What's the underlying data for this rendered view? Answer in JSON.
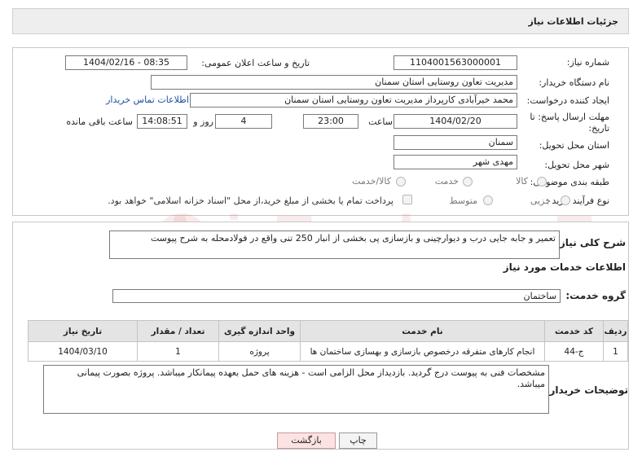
{
  "header": {
    "title": "جزئیات اطلاعات نیاز"
  },
  "form": {
    "need_number_label": "شماره نیاز:",
    "need_number": "1104001563000001",
    "announce_label": "تاریخ و ساعت اعلان عمومی:",
    "announce_value": "1404/02/16 - 08:35",
    "buyer_org_label": "نام دستگاه خریدار:",
    "buyer_org": "مدیریت تعاون روستایی استان سمنان",
    "requester_label": "ایجاد کننده درخواست:",
    "requester": "محمد خیرآبادی کارپرداز مدیریت تعاون روستایی استان سمنان",
    "contact_link": "اطلاعات تماس خریدار",
    "deadline_label": "مهلت ارسال پاسخ: تا تاریخ:",
    "deadline_date": "1404/02/20",
    "time_label": "ساعت",
    "deadline_time": "23:00",
    "days_value": "4",
    "days_label": "روز و",
    "remaining_time": "14:08:51",
    "remaining_label": "ساعت باقی مانده",
    "province_label": "استان محل تحویل:",
    "province": "سمنان",
    "city_label": "شهر محل تحویل:",
    "city": "مهدی شهر",
    "category_label": "طبقه بندی موضوعی:",
    "category_options": [
      "کالا",
      "خدمت",
      "کالا/خدمت"
    ],
    "process_label": "نوع فرآیند خرید :",
    "process_options": [
      "جزیی",
      "متوسط"
    ],
    "payment_note": "پرداخت تمام یا بخشی از مبلغ خرید،از محل \"اسناد خزانه اسلامی\" خواهد بود."
  },
  "summary": {
    "label": "شرح کلی نیاز:",
    "text": "تعمیر و جابه جایی درب و دیوارچینی و بازسازی پی بخشی از انبار 250 تنی واقع در فولادمحله به شرح پیوست"
  },
  "services": {
    "section_title": "اطلاعات خدمات مورد نیاز",
    "group_label": "گروه خدمت:",
    "group_value": "ساختمان",
    "columns": [
      "ردیف",
      "کد خدمت",
      "نام خدمت",
      "واحد اندازه گیری",
      "تعداد / مقدار",
      "تاریخ نیاز"
    ],
    "rows": [
      [
        "1",
        "ج-44",
        "انجام کارهای متفرقه درخصوص بازسازی و بهسازی ساختمان ها",
        "پروژه",
        "1",
        "1404/03/10"
      ]
    ]
  },
  "buyer_notes": {
    "label": "توضیحات خریدار:",
    "text": "مشخصات فنی به پیوست درج گردید. بازدیداز محل الزامی است - هزینه های  حمل بعهده پیمانکار میباشد. پروژه بصورت پیمانی میباشد."
  },
  "buttons": {
    "print": "چاپ",
    "back": "بازگشت"
  },
  "watermark": "AriaTender.neT"
}
